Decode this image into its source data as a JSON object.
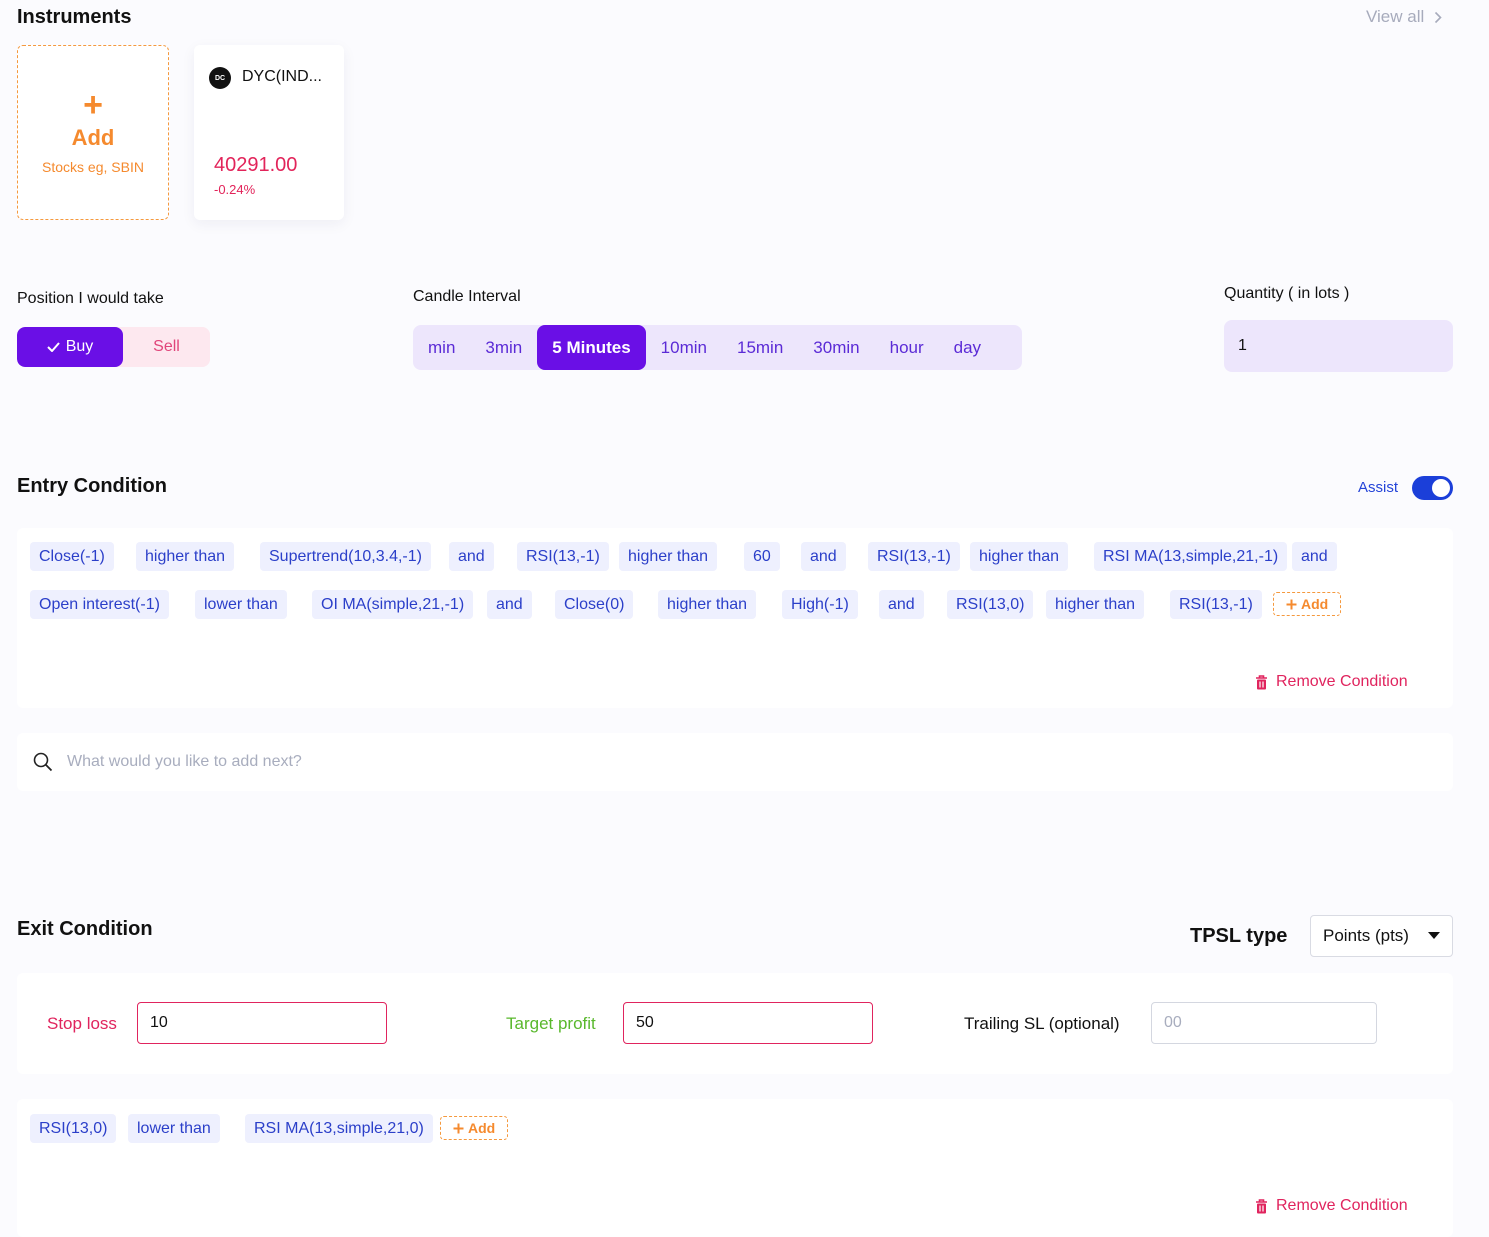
{
  "instruments": {
    "title": "Instruments",
    "view_all": "View all",
    "add_card": {
      "plus": "+",
      "label": "Add",
      "hint": "Stocks eg, SBIN"
    },
    "items": [
      {
        "logo": "DC",
        "name": "DYC(IND...",
        "price": "40291.00",
        "change": "-0.24%"
      }
    ]
  },
  "position": {
    "label": "Position I would take",
    "buy": "Buy",
    "sell": "Sell",
    "selected": "Buy"
  },
  "candle": {
    "label": "Candle Interval",
    "options": [
      "min",
      "3min",
      "5 Minutes",
      "10min",
      "15min",
      "30min",
      "hour",
      "day"
    ],
    "selected": "5 Minutes"
  },
  "quantity": {
    "label": "Quantity ( in lots )",
    "value": "1"
  },
  "entry": {
    "title": "Entry Condition",
    "assist_label": "Assist",
    "assist_on": true,
    "chips_row1": [
      "Close(-1)",
      "higher than",
      "Supertrend(10,3.4,-1)",
      "and",
      "RSI(13,-1)",
      "higher than",
      "60",
      "and",
      "RSI(13,-1)",
      "higher than",
      "RSI MA(13,simple,21,-1)",
      "and"
    ],
    "chips_row2": [
      "Open interest(-1)",
      "lower than",
      "OI MA(simple,21,-1)",
      "and",
      "Close(0)",
      "higher than",
      "High(-1)",
      "and",
      "RSI(13,0)",
      "higher than",
      "RSI(13,-1)"
    ],
    "add_label": "Add",
    "remove_label": "Remove Condition",
    "search_placeholder": "What would you like to add next?"
  },
  "exit": {
    "title": "Exit Condition",
    "tpsl_label": "TPSL type",
    "tpsl_value": "Points (pts)",
    "stop_loss_label": "Stop loss",
    "stop_loss_value": "10",
    "target_label": "Target profit",
    "target_value": "50",
    "trailing_label": "Trailing SL (optional)",
    "trailing_placeholder": "00",
    "chips": [
      "RSI(13,0)",
      "lower than",
      "RSI MA(13,simple,21,0)"
    ],
    "add_label": "Add",
    "remove_label": "Remove Condition"
  },
  "colors": {
    "accent": "#6a0fe6",
    "add_orange": "#f58a2e",
    "danger": "#e0245e",
    "success": "#59b82c",
    "chip_text": "#2b3fc9",
    "toggle": "#1b3fd9"
  },
  "icons": [
    "plus-icon",
    "chevron-right-icon",
    "check-icon",
    "trash-icon",
    "search-icon",
    "caret-down-icon"
  ]
}
